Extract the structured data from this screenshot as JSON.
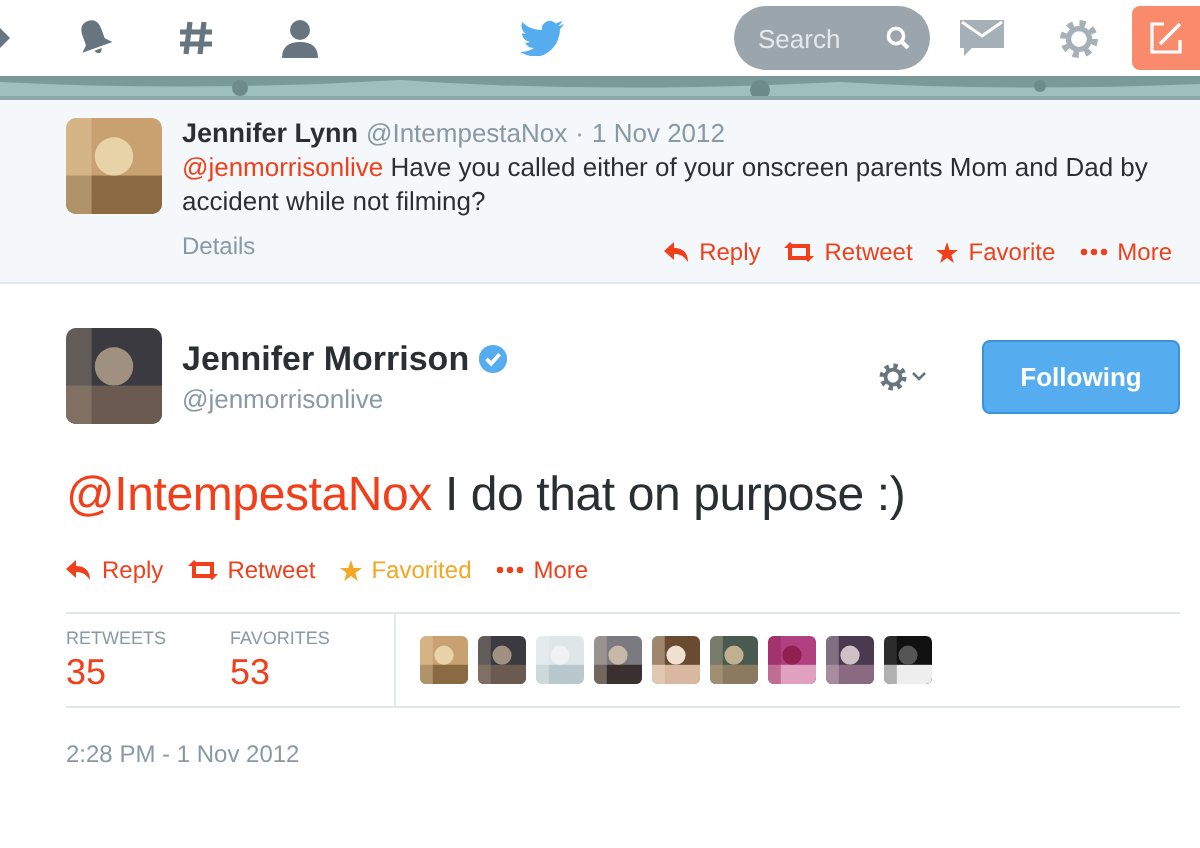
{
  "nav": {
    "search": {
      "placeholder": "Search"
    }
  },
  "reply_tweet": {
    "name": "Jennifer Lynn",
    "handle": "@IntempestaNox",
    "dot": "·",
    "date": "1 Nov 2012",
    "mention": "@jenmorrisonlive",
    "text": "Have you called either of your onscreen parents Mom and Dad by accident while not filming?",
    "details": "Details",
    "actions": [
      {
        "kind": "reply",
        "label": "Reply",
        "on": false
      },
      {
        "kind": "retweet",
        "label": "Retweet",
        "on": false
      },
      {
        "kind": "favorite",
        "label": "Favorite",
        "on": false
      },
      {
        "kind": "more",
        "label": "More",
        "on": false
      }
    ]
  },
  "main_tweet": {
    "name": "Jennifer Morrison",
    "verified": true,
    "handle": "@jenmorrisonlive",
    "follow_button": "Following",
    "mention": "@IntempestaNox",
    "text": "I do that on purpose :)",
    "actions": [
      {
        "kind": "reply",
        "label": "Reply",
        "on": false
      },
      {
        "kind": "retweet",
        "label": "Retweet",
        "on": false
      },
      {
        "kind": "favorite",
        "label": "Favorited",
        "on": true
      },
      {
        "kind": "more",
        "label": "More",
        "on": false
      }
    ],
    "stats": [
      {
        "label": "RETWEETS",
        "value": "35"
      },
      {
        "label": "FAVORITES",
        "value": "53"
      }
    ],
    "timestamp": "2:28 PM - 1 Nov 2012"
  }
}
